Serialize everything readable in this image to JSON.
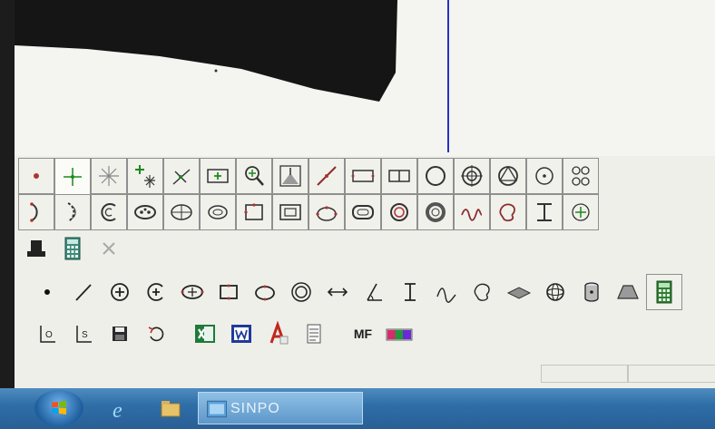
{
  "app": {
    "toolbar_button_text": {
      "mf": "MF"
    }
  },
  "taskbar": {
    "program_label": "SINPO"
  },
  "colors": {
    "canvas_bg": "#f4f4f0",
    "dark_shape": "#151515",
    "axis_line": "#2233c8",
    "panel_bg": "#efefe9",
    "taskbar": "#2f6ea8"
  },
  "toolbars": {
    "row1": [
      "point-dot-icon",
      "crosshair-point-icon",
      "star-point-icon",
      "multi-point-icon",
      "intersection-icon",
      "bracket-point-icon",
      "zoom-point-icon",
      "peak-point-icon",
      "line-icon",
      "rectangle-slot-icon",
      "double-slot-icon",
      "circle-icon",
      "target-circle-icon",
      "triangle-circle-icon",
      "center-circle-icon",
      "pattern-circles-icon"
    ],
    "row2": [
      "arc-icon",
      "arc-dashed-icon",
      "curve-c-icon",
      "ellipse-point-icon",
      "ellipse-cross-icon",
      "ellipse-icon",
      "square-slot-icon",
      "square-rect-icon",
      "circle-dots-icon",
      "rounded-rect-icon",
      "ring-dots-icon",
      "donut-icon",
      "wave-icon",
      "blob-icon",
      "width-icon",
      "small-crosshair-icon"
    ],
    "row3": [
      "probe-icon",
      "calculator-icon",
      "cross-disabled-icon"
    ],
    "row4": [
      "dot-icon",
      "line-tool-icon",
      "circle-plus-icon",
      "arc-plus-icon",
      "ellipse-tool-icon",
      "rect-tool-icon",
      "ellipse-dimension-icon",
      "ring-tool-icon",
      "double-arrow-icon",
      "angle-icon",
      "vertical-distance-icon",
      "curve-tool-icon",
      "freeform-icon",
      "plane-icon",
      "sphere-icon",
      "cylinder-icon",
      "cone-icon",
      "calculator-green-icon"
    ],
    "row5_left": [
      "origin-icon",
      "coordinate-icon",
      "save-icon",
      "undo-icon"
    ],
    "row5_right": [
      "excel-icon",
      "word-icon",
      "pdf-icon",
      "notepad-icon"
    ],
    "row5_end": [
      "mf-button",
      "color-bar-icon"
    ]
  }
}
